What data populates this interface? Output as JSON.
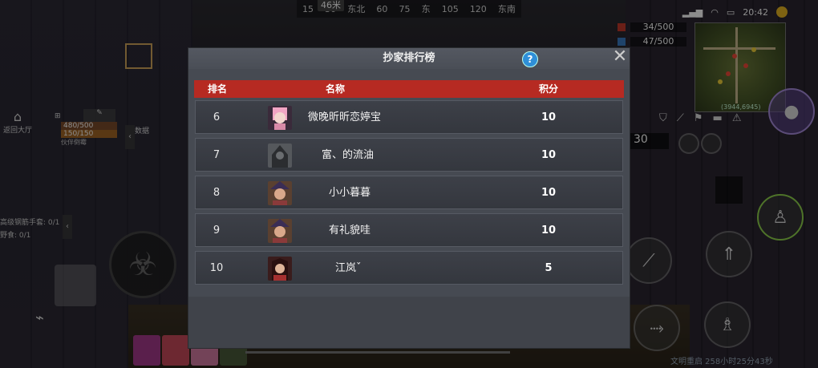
{
  "compass": {
    "distance": "46米",
    "ticks": [
      "15",
      "30",
      "东北",
      "60",
      "75",
      "东",
      "105",
      "120",
      "东南"
    ]
  },
  "status": {
    "time": "20:42"
  },
  "resources": [
    {
      "value": "34/500",
      "color": "#c23a2a"
    },
    {
      "value": "47/500",
      "color": "#3a7bc2"
    }
  ],
  "minimap": {
    "coord": "(3944,6945)"
  },
  "left_hud": {
    "lobby_label": "返回大厅",
    "hp_text": "480/500",
    "hp_text2": "150/150",
    "partner_label": "伙伴倒霉",
    "data_label": "数据",
    "task1": "高级钢筋手套: 0/1",
    "task2": "野食: 0/1"
  },
  "right_hud": {
    "ammo": "30"
  },
  "bottom": {
    "info": "文明重启 258小时25分43秒"
  },
  "modal": {
    "title": "抄家排行榜",
    "columns": {
      "rank": "排名",
      "name": "名称",
      "score": "积分"
    },
    "rows": [
      {
        "rank": "6",
        "name": "微晚昕昕恋婷宝",
        "score": "10",
        "avatar_color": "#d98aa8",
        "avatar_hair": "#f2a5c4"
      },
      {
        "rank": "7",
        "name": "富、的流油",
        "score": "10",
        "avatar_color": "#4a4d52",
        "avatar_hair": "#2b2d30"
      },
      {
        "rank": "8",
        "name": "小小暮暮",
        "score": "10",
        "avatar_color": "#7a4a3a",
        "avatar_hair": "#3a2d55"
      },
      {
        "rank": "9",
        "name": "有礼貌哇",
        "score": "10",
        "avatar_color": "#7a4a3a",
        "avatar_hair": "#3a2d55"
      },
      {
        "rank": "10",
        "name": "江岚ˇ",
        "score": "5",
        "avatar_color": "#8a3a3a",
        "avatar_hair": "#3a1c1c"
      }
    ]
  }
}
